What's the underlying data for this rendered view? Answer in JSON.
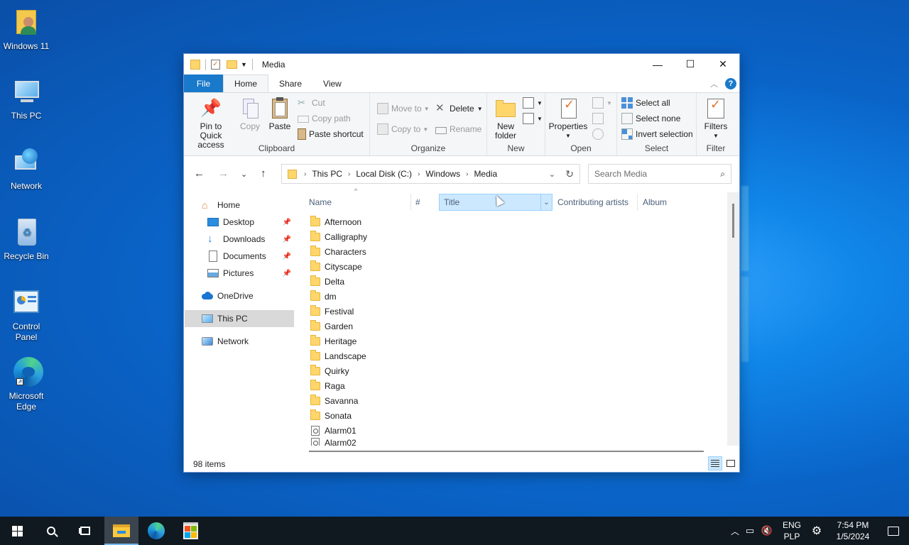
{
  "desktop": {
    "icons": [
      {
        "label": "Windows 11",
        "icon": "user-folder-icon"
      },
      {
        "label": "This PC",
        "icon": "computer-icon"
      },
      {
        "label": "Network",
        "icon": "network-globe-icon"
      },
      {
        "label": "Recycle Bin",
        "icon": "recycle-bin-icon"
      },
      {
        "label": "Control Panel",
        "icon": "control-panel-icon"
      },
      {
        "label": "Microsoft Edge",
        "icon": "edge-icon"
      }
    ]
  },
  "window": {
    "title": "Media",
    "controls": {
      "minimize": "—",
      "maximize": "☐",
      "close": "✕"
    },
    "tabs": [
      "File",
      "Home",
      "Share",
      "View"
    ],
    "active_tab": "Home",
    "ribbon": {
      "clipboard": {
        "label": "Clipboard",
        "pin": "Pin to Quick access",
        "copy": "Copy",
        "paste": "Paste",
        "cut": "Cut",
        "copy_path": "Copy path",
        "paste_shortcut": "Paste shortcut"
      },
      "organize": {
        "label": "Organize",
        "move_to": "Move to",
        "copy_to": "Copy to",
        "delete": "Delete",
        "rename": "Rename"
      },
      "new": {
        "label": "New",
        "new_folder": "New folder"
      },
      "open": {
        "label": "Open",
        "properties": "Properties"
      },
      "select": {
        "label": "Select",
        "select_all": "Select all",
        "select_none": "Select none",
        "invert": "Invert selection"
      },
      "filter": {
        "label": "Filter",
        "filters": "Filters"
      }
    },
    "address": {
      "breadcrumbs": [
        "This PC",
        "Local Disk (C:)",
        "Windows",
        "Media"
      ],
      "search_placeholder": "Search Media"
    },
    "nav_pane": {
      "items": [
        {
          "label": "Home",
          "icon": "home-icon"
        },
        {
          "label": "Desktop",
          "icon": "desktop-icon",
          "pinned": true
        },
        {
          "label": "Downloads",
          "icon": "download-arrow-icon",
          "pinned": true
        },
        {
          "label": "Documents",
          "icon": "documents-icon",
          "pinned": true
        },
        {
          "label": "Pictures",
          "icon": "pictures-icon",
          "pinned": true
        },
        {
          "label": "OneDrive",
          "icon": "cloud-icon"
        },
        {
          "label": "This PC",
          "icon": "computer-icon",
          "selected": true
        },
        {
          "label": "Network",
          "icon": "network-icon"
        }
      ]
    },
    "columns": [
      "Name",
      "#",
      "Title",
      "Contributing artists",
      "Album"
    ],
    "files": [
      {
        "name": "Afternoon",
        "type": "folder"
      },
      {
        "name": "Calligraphy",
        "type": "folder"
      },
      {
        "name": "Characters",
        "type": "folder"
      },
      {
        "name": "Cityscape",
        "type": "folder"
      },
      {
        "name": "Delta",
        "type": "folder"
      },
      {
        "name": "dm",
        "type": "folder"
      },
      {
        "name": "Festival",
        "type": "folder"
      },
      {
        "name": "Garden",
        "type": "folder"
      },
      {
        "name": "Heritage",
        "type": "folder"
      },
      {
        "name": "Landscape",
        "type": "folder"
      },
      {
        "name": "Quirky",
        "type": "folder"
      },
      {
        "name": "Raga",
        "type": "folder"
      },
      {
        "name": "Savanna",
        "type": "folder"
      },
      {
        "name": "Sonata",
        "type": "folder"
      },
      {
        "name": "Alarm01",
        "type": "audio"
      },
      {
        "name": "Alarm02",
        "type": "audio"
      }
    ],
    "status": "98 items"
  },
  "taskbar": {
    "lang_top": "ENG",
    "lang_bottom": "PLP",
    "time": "7:54 PM",
    "date": "1/5/2024"
  },
  "colors": {
    "accent": "#1979ca",
    "selection": "#cce8ff",
    "taskbar": "#101820",
    "folder": "#ffd66b"
  }
}
